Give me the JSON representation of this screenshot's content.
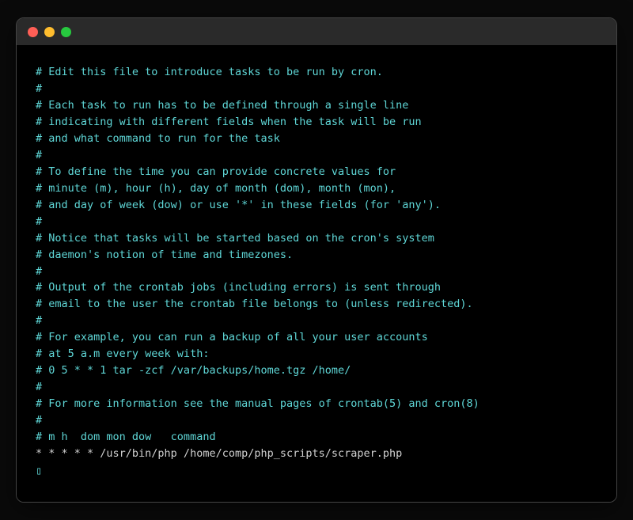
{
  "titlebar": {
    "close": "close",
    "minimize": "minimize",
    "maximize": "maximize"
  },
  "lines": [
    {
      "text": "# Edit this file to introduce tasks to be run by cron.",
      "cls": ""
    },
    {
      "text": "#",
      "cls": ""
    },
    {
      "text": "# Each task to run has to be defined through a single line",
      "cls": ""
    },
    {
      "text": "# indicating with different fields when the task will be run",
      "cls": ""
    },
    {
      "text": "# and what command to run for the task",
      "cls": ""
    },
    {
      "text": "#",
      "cls": ""
    },
    {
      "text": "# To define the time you can provide concrete values for",
      "cls": ""
    },
    {
      "text": "# minute (m), hour (h), day of month (dom), month (mon),",
      "cls": ""
    },
    {
      "text": "# and day of week (dow) or use '*' in these fields (for 'any').",
      "cls": ""
    },
    {
      "text": "#",
      "cls": ""
    },
    {
      "text": "# Notice that tasks will be started based on the cron's system",
      "cls": ""
    },
    {
      "text": "# daemon's notion of time and timezones.",
      "cls": ""
    },
    {
      "text": "#",
      "cls": ""
    },
    {
      "text": "# Output of the crontab jobs (including errors) is sent through",
      "cls": ""
    },
    {
      "text": "# email to the user the crontab file belongs to (unless redirected).",
      "cls": ""
    },
    {
      "text": "#",
      "cls": ""
    },
    {
      "text": "# For example, you can run a backup of all your user accounts",
      "cls": ""
    },
    {
      "text": "# at 5 a.m every week with:",
      "cls": ""
    },
    {
      "text": "# 0 5 * * 1 tar -zcf /var/backups/home.tgz /home/",
      "cls": ""
    },
    {
      "text": "#",
      "cls": ""
    },
    {
      "text": "# For more information see the manual pages of crontab(5) and cron(8)",
      "cls": ""
    },
    {
      "text": "#",
      "cls": ""
    },
    {
      "text": "# m h  dom mon dow   command",
      "cls": ""
    },
    {
      "text": "* * * * * /usr/bin/php /home/comp/php_scripts/scraper.php",
      "cls": "cmd"
    }
  ],
  "cursor": "▯"
}
